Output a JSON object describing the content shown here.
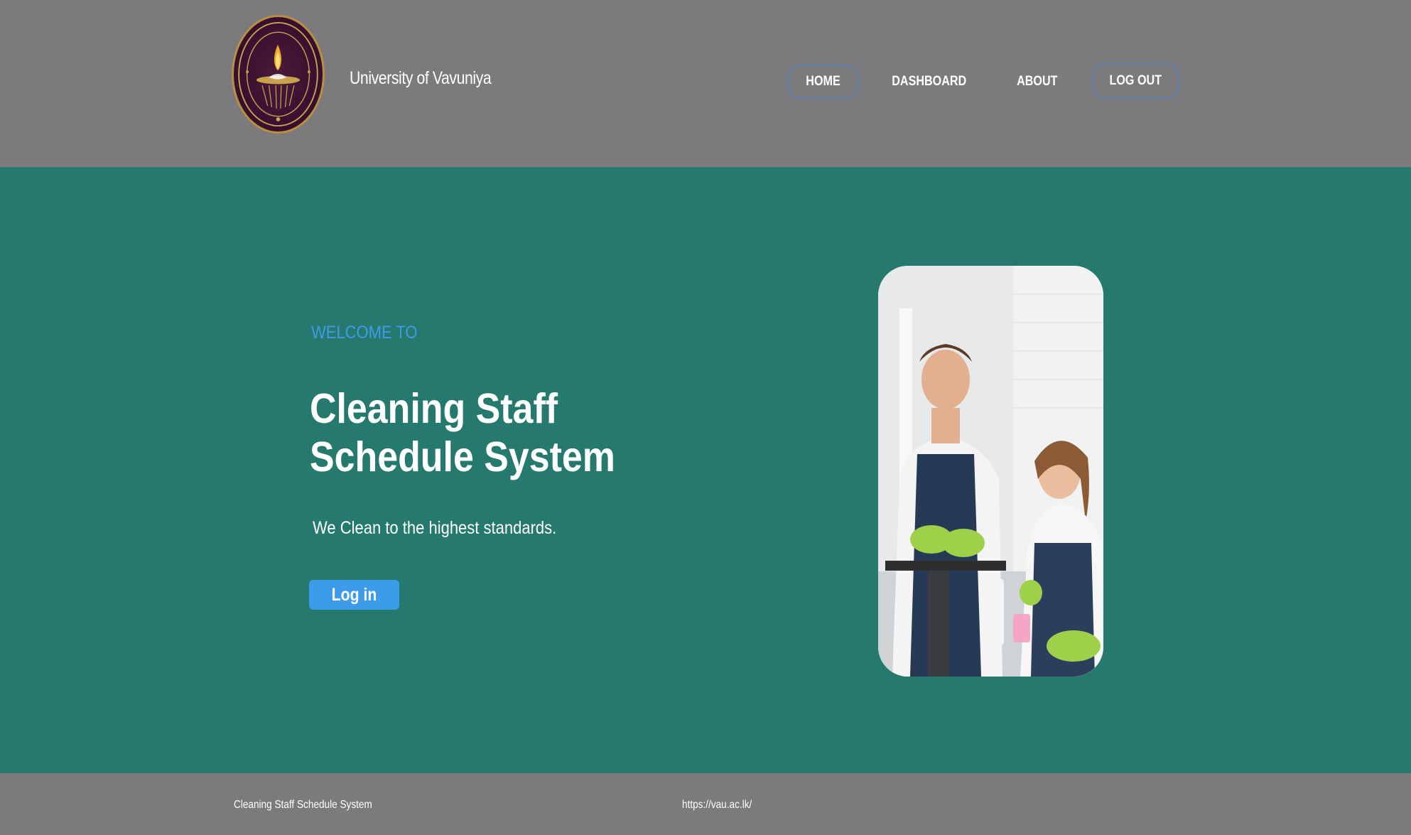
{
  "header": {
    "logo_icon": "university-seal-icon",
    "brand": "University of Vavuniya",
    "nav": [
      {
        "label": "HOME"
      },
      {
        "label": "DASHBOARD"
      },
      {
        "label": "ABOUT"
      },
      {
        "label": "LOG OUT"
      }
    ]
  },
  "hero": {
    "welcome": "WELCOME TO",
    "title_line1": "Cleaning Staff",
    "title_line2": "Schedule System",
    "subtitle": "We Clean to the highest standards.",
    "login_label": "Log in",
    "image": "cleaning-staff-photo"
  },
  "footer": {
    "left_text": "Cleaning Staff Schedule System",
    "link": "https://vau.ac.lk/"
  },
  "colors": {
    "header_bg": "#7b7b7d",
    "hero_bg": "#26796d",
    "accent_blue": "#3d9ce9",
    "welcome_blue": "#3f9be8"
  }
}
